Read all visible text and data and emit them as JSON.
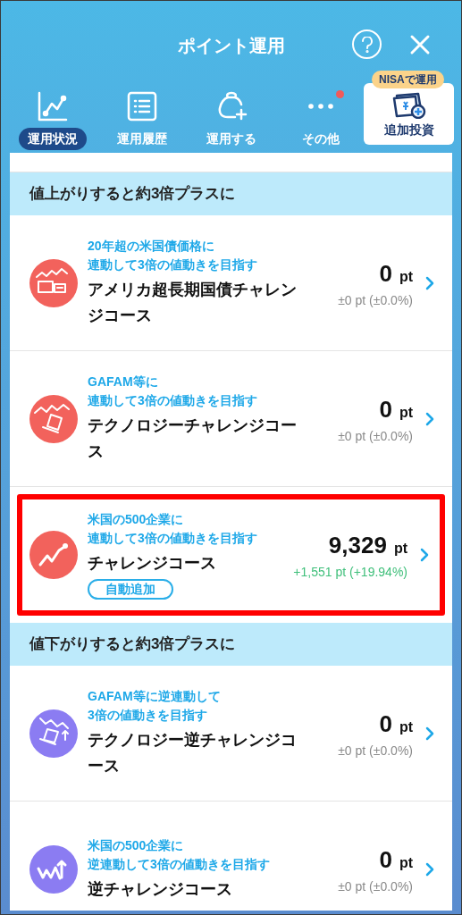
{
  "header": {
    "title": "ポイント運用"
  },
  "tabs": [
    {
      "label": "運用状況",
      "kind": "chart",
      "selected": true,
      "notification": false
    },
    {
      "label": "運用履歴",
      "kind": "list",
      "selected": false,
      "notification": false
    },
    {
      "label": "運用する",
      "kind": "bag",
      "selected": false,
      "notification": false
    },
    {
      "label": "その他",
      "kind": "dots",
      "selected": false,
      "notification": true
    }
  ],
  "featured_tab": {
    "tag": "NISAで運用",
    "label": "追加投資"
  },
  "sections": [
    {
      "title": "値上がりすると約3倍プラスに",
      "courses": [
        {
          "kind": "bond",
          "color": "#f2625c",
          "subtitle": [
            "20年超の米国債価格に",
            "連動して3倍の値動きを目指す"
          ],
          "name": "アメリカ超長期国債チャレンジコース",
          "value": "0",
          "unit": "pt",
          "change": "±0 pt (±0.0%)",
          "gain": false,
          "highlighted": false
        },
        {
          "kind": "tech",
          "color": "#f2625c",
          "subtitle": [
            "GAFAM等に",
            "連動して3倍の値動きを目指す"
          ],
          "name": "テクノロジーチャレンジコース",
          "value": "0",
          "unit": "pt",
          "change": "±0 pt (±0.0%)",
          "gain": false,
          "highlighted": false
        },
        {
          "kind": "index",
          "color": "#f2625c",
          "subtitle": [
            "米国の500企業に",
            "連動して3倍の値動きを目指す"
          ],
          "name": "チャレンジコース",
          "badge": "自動追加",
          "value": "9,329",
          "unit": "pt",
          "change": "+1,551 pt (+19.94%)",
          "gain": true,
          "highlighted": true
        }
      ]
    },
    {
      "title": "値下がりすると約3倍プラスに",
      "courses": [
        {
          "kind": "tech_inverse",
          "color": "#8b7cf2",
          "subtitle": [
            "GAFAM等に逆連動して",
            "3倍の値動きを目指す"
          ],
          "name": "テクノロジー逆チャレンジコース",
          "value": "0",
          "unit": "pt",
          "change": "±0 pt (±0.0%)",
          "gain": false,
          "highlighted": false
        },
        {
          "kind": "index_inverse",
          "color": "#8b7cf2",
          "subtitle": [
            "米国の500企業に",
            "逆連動して3倍の値動きを目指す"
          ],
          "name": "逆チャレンジコース",
          "value": "0",
          "unit": "pt",
          "change": "±0 pt (±0.0%)",
          "gain": false,
          "highlighted": false
        }
      ]
    }
  ]
}
